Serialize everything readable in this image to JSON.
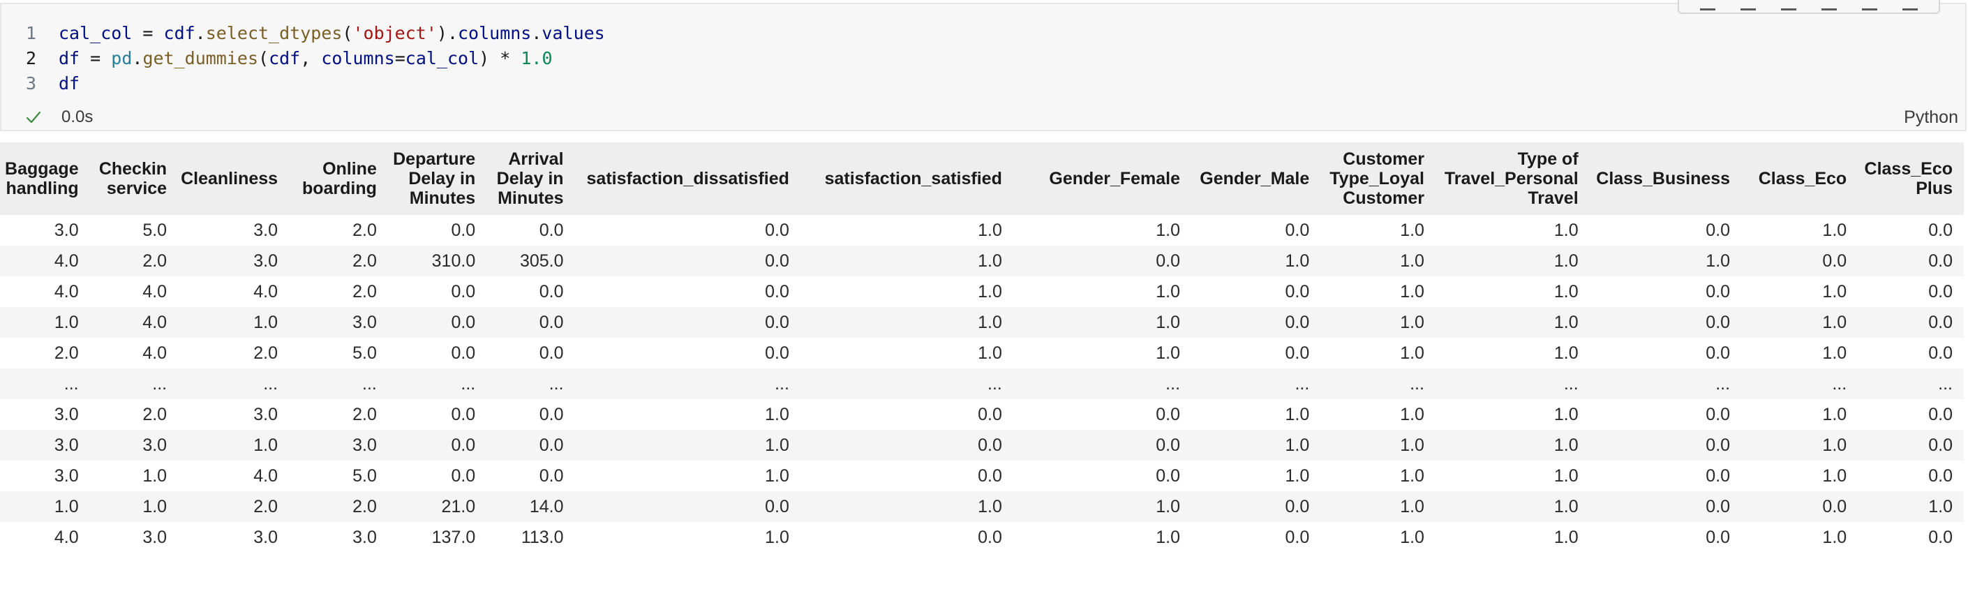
{
  "cell": {
    "line_numbers": [
      "1",
      "2",
      "3"
    ],
    "code": {
      "line1": [
        {
          "t": "cal_col",
          "c": "var"
        },
        {
          "t": " = ",
          "c": "op"
        },
        {
          "t": "cdf",
          "c": "var"
        },
        {
          "t": ".",
          "c": "op"
        },
        {
          "t": "select_dtypes",
          "c": "fn"
        },
        {
          "t": "(",
          "c": "op"
        },
        {
          "t": "'object'",
          "c": "str"
        },
        {
          "t": ").",
          "c": "op"
        },
        {
          "t": "columns",
          "c": "var"
        },
        {
          "t": ".",
          "c": "op"
        },
        {
          "t": "values",
          "c": "var"
        }
      ],
      "line2": [
        {
          "t": "df",
          "c": "var"
        },
        {
          "t": " = ",
          "c": "op"
        },
        {
          "t": "pd",
          "c": "mod"
        },
        {
          "t": ".",
          "c": "op"
        },
        {
          "t": "get_dummies",
          "c": "fn"
        },
        {
          "t": "(",
          "c": "op"
        },
        {
          "t": "cdf",
          "c": "var"
        },
        {
          "t": ", ",
          "c": "op"
        },
        {
          "t": "columns",
          "c": "var"
        },
        {
          "t": "=",
          "c": "op"
        },
        {
          "t": "cal_col",
          "c": "var"
        },
        {
          "t": ") * ",
          "c": "op"
        },
        {
          "t": "1.0",
          "c": "num"
        }
      ],
      "line3": [
        {
          "t": "df",
          "c": "var"
        }
      ]
    },
    "exec_time": "0.0s",
    "language": "Python",
    "status_icon": "check-icon",
    "status_color": "#3c8a3c"
  },
  "table": {
    "columns": [
      [
        "Baggage",
        "handling"
      ],
      [
        "Checkin",
        "service"
      ],
      [
        "Cleanliness"
      ],
      [
        "Online",
        "boarding"
      ],
      [
        "Departure",
        "Delay in",
        "Minutes"
      ],
      [
        "Arrival",
        "Delay in",
        "Minutes"
      ],
      [
        "satisfaction_dissatisfied"
      ],
      [
        "satisfaction_satisfied"
      ],
      [
        "Gender_Female"
      ],
      [
        "Gender_Male"
      ],
      [
        "Customer",
        "Type_Loyal",
        "Customer"
      ],
      [
        "Type of",
        "Travel_Personal",
        "Travel"
      ],
      [
        "Class_Business"
      ],
      [
        "Class_Eco"
      ],
      [
        "Class_Eco",
        "Plus"
      ]
    ],
    "rows": [
      [
        "3.0",
        "5.0",
        "3.0",
        "2.0",
        "0.0",
        "0.0",
        "0.0",
        "1.0",
        "1.0",
        "0.0",
        "1.0",
        "1.0",
        "0.0",
        "1.0",
        "0.0"
      ],
      [
        "4.0",
        "2.0",
        "3.0",
        "2.0",
        "310.0",
        "305.0",
        "0.0",
        "1.0",
        "0.0",
        "1.0",
        "1.0",
        "1.0",
        "1.0",
        "0.0",
        "0.0"
      ],
      [
        "4.0",
        "4.0",
        "4.0",
        "2.0",
        "0.0",
        "0.0",
        "0.0",
        "1.0",
        "1.0",
        "0.0",
        "1.0",
        "1.0",
        "0.0",
        "1.0",
        "0.0"
      ],
      [
        "1.0",
        "4.0",
        "1.0",
        "3.0",
        "0.0",
        "0.0",
        "0.0",
        "1.0",
        "1.0",
        "0.0",
        "1.0",
        "1.0",
        "0.0",
        "1.0",
        "0.0"
      ],
      [
        "2.0",
        "4.0",
        "2.0",
        "5.0",
        "0.0",
        "0.0",
        "0.0",
        "1.0",
        "1.0",
        "0.0",
        "1.0",
        "1.0",
        "0.0",
        "1.0",
        "0.0"
      ],
      [
        "...",
        "...",
        "...",
        "...",
        "...",
        "...",
        "...",
        "...",
        "...",
        "...",
        "...",
        "...",
        "...",
        "...",
        "..."
      ],
      [
        "3.0",
        "2.0",
        "3.0",
        "2.0",
        "0.0",
        "0.0",
        "1.0",
        "0.0",
        "0.0",
        "1.0",
        "1.0",
        "1.0",
        "0.0",
        "1.0",
        "0.0"
      ],
      [
        "3.0",
        "3.0",
        "1.0",
        "3.0",
        "0.0",
        "0.0",
        "1.0",
        "0.0",
        "0.0",
        "1.0",
        "1.0",
        "1.0",
        "0.0",
        "1.0",
        "0.0"
      ],
      [
        "3.0",
        "1.0",
        "4.0",
        "5.0",
        "0.0",
        "0.0",
        "1.0",
        "0.0",
        "0.0",
        "1.0",
        "1.0",
        "1.0",
        "0.0",
        "1.0",
        "0.0"
      ],
      [
        "1.0",
        "1.0",
        "2.0",
        "2.0",
        "21.0",
        "14.0",
        "0.0",
        "1.0",
        "1.0",
        "0.0",
        "1.0",
        "1.0",
        "0.0",
        "0.0",
        "1.0"
      ],
      [
        "4.0",
        "3.0",
        "3.0",
        "3.0",
        "137.0",
        "113.0",
        "1.0",
        "0.0",
        "1.0",
        "0.0",
        "1.0",
        "1.0",
        "0.0",
        "1.0",
        "0.0"
      ]
    ]
  }
}
